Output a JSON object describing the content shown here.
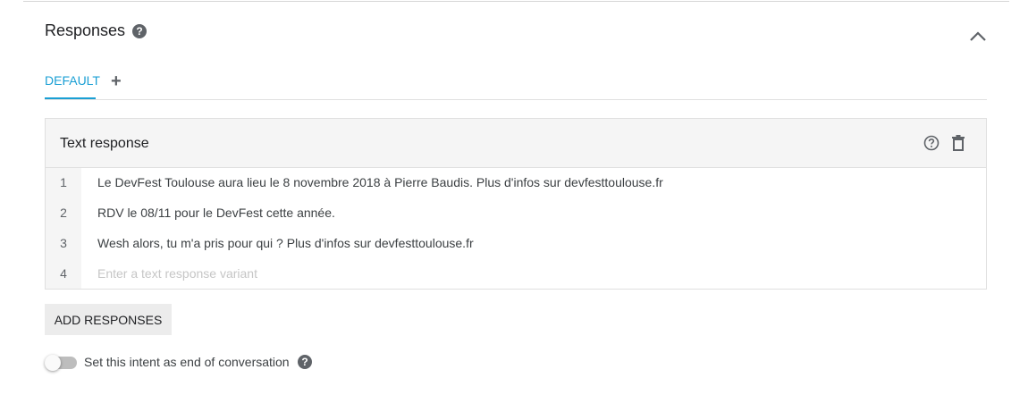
{
  "section": {
    "title": "Responses",
    "help_icon": "help-circle-icon",
    "collapse_icon": "chevron-up-icon"
  },
  "tabs": {
    "items": [
      {
        "label": "DEFAULT",
        "active": true
      }
    ],
    "add_label": "+"
  },
  "text_response": {
    "title": "Text response",
    "rows": [
      {
        "num": "1",
        "text": "Le DevFest Toulouse aura lieu le 8 novembre 2018 à Pierre Baudis. Plus d'infos sur devfesttoulouse.fr"
      },
      {
        "num": "2",
        "text": "RDV le 08/11 pour le DevFest cette année."
      },
      {
        "num": "3",
        "text": "Wesh alors, tu m'a pris pour qui ?  Plus d'infos sur devfesttoulouse.fr"
      }
    ],
    "new_row_num": "4",
    "new_row_placeholder": "Enter a text response variant"
  },
  "add_responses_label": "ADD RESPONSES",
  "end_conversation": {
    "label": "Set this intent as end of conversation",
    "enabled": false
  },
  "colors": {
    "accent": "#1a9fd4",
    "icon_gray": "#5f6368",
    "header_bg": "#f5f5f5"
  }
}
